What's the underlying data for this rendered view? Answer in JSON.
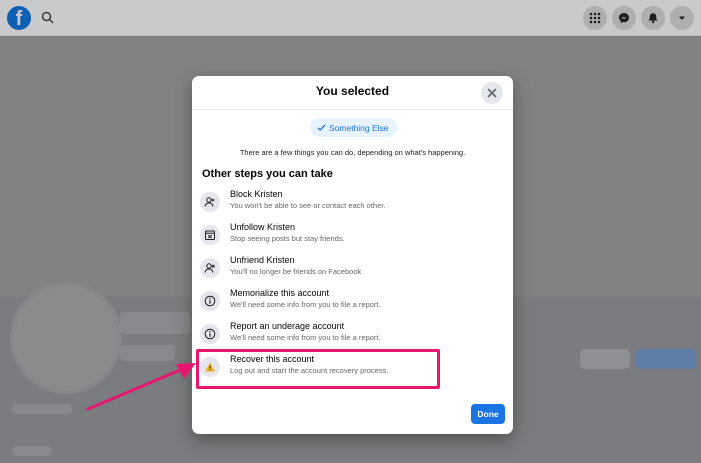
{
  "topbar": {
    "logo_letter": "f",
    "icons": [
      "search-icon",
      "menu-grid-icon",
      "messenger-icon",
      "notifications-bell-icon",
      "account-dropdown-icon"
    ]
  },
  "modal": {
    "title": "You selected",
    "selected_option": "Something Else",
    "info_text": "There are a few things you can do, depending on what's happening.",
    "section_title": "Other steps you can take",
    "options": [
      {
        "title": "Block Kristen",
        "description": "You won't be able to see or contact each other.",
        "icon": "block-user-icon"
      },
      {
        "title": "Unfollow Kristen",
        "description": "Stop seeing posts but stay friends.",
        "icon": "unfollow-icon"
      },
      {
        "title": "Unfriend Kristen",
        "description": "You'll no longer be friends on Facebook",
        "icon": "unfriend-icon"
      },
      {
        "title": "Memorialize this account",
        "description": "We'll need some info from you to file a report.",
        "icon": "info-icon"
      },
      {
        "title": "Report an underage account",
        "description": "We'll need some info from you to file a report.",
        "icon": "info-icon"
      },
      {
        "title": "Recover this account",
        "description": "Log out and start the account recovery process.",
        "icon": "warning-icon"
      }
    ],
    "done_label": "Done"
  },
  "annotation": {
    "highlight_color": "#e5176e",
    "highlighted_option": "Recover this account"
  },
  "colors": {
    "accent": "#1b74e4",
    "overlay": "#7d7f82"
  }
}
